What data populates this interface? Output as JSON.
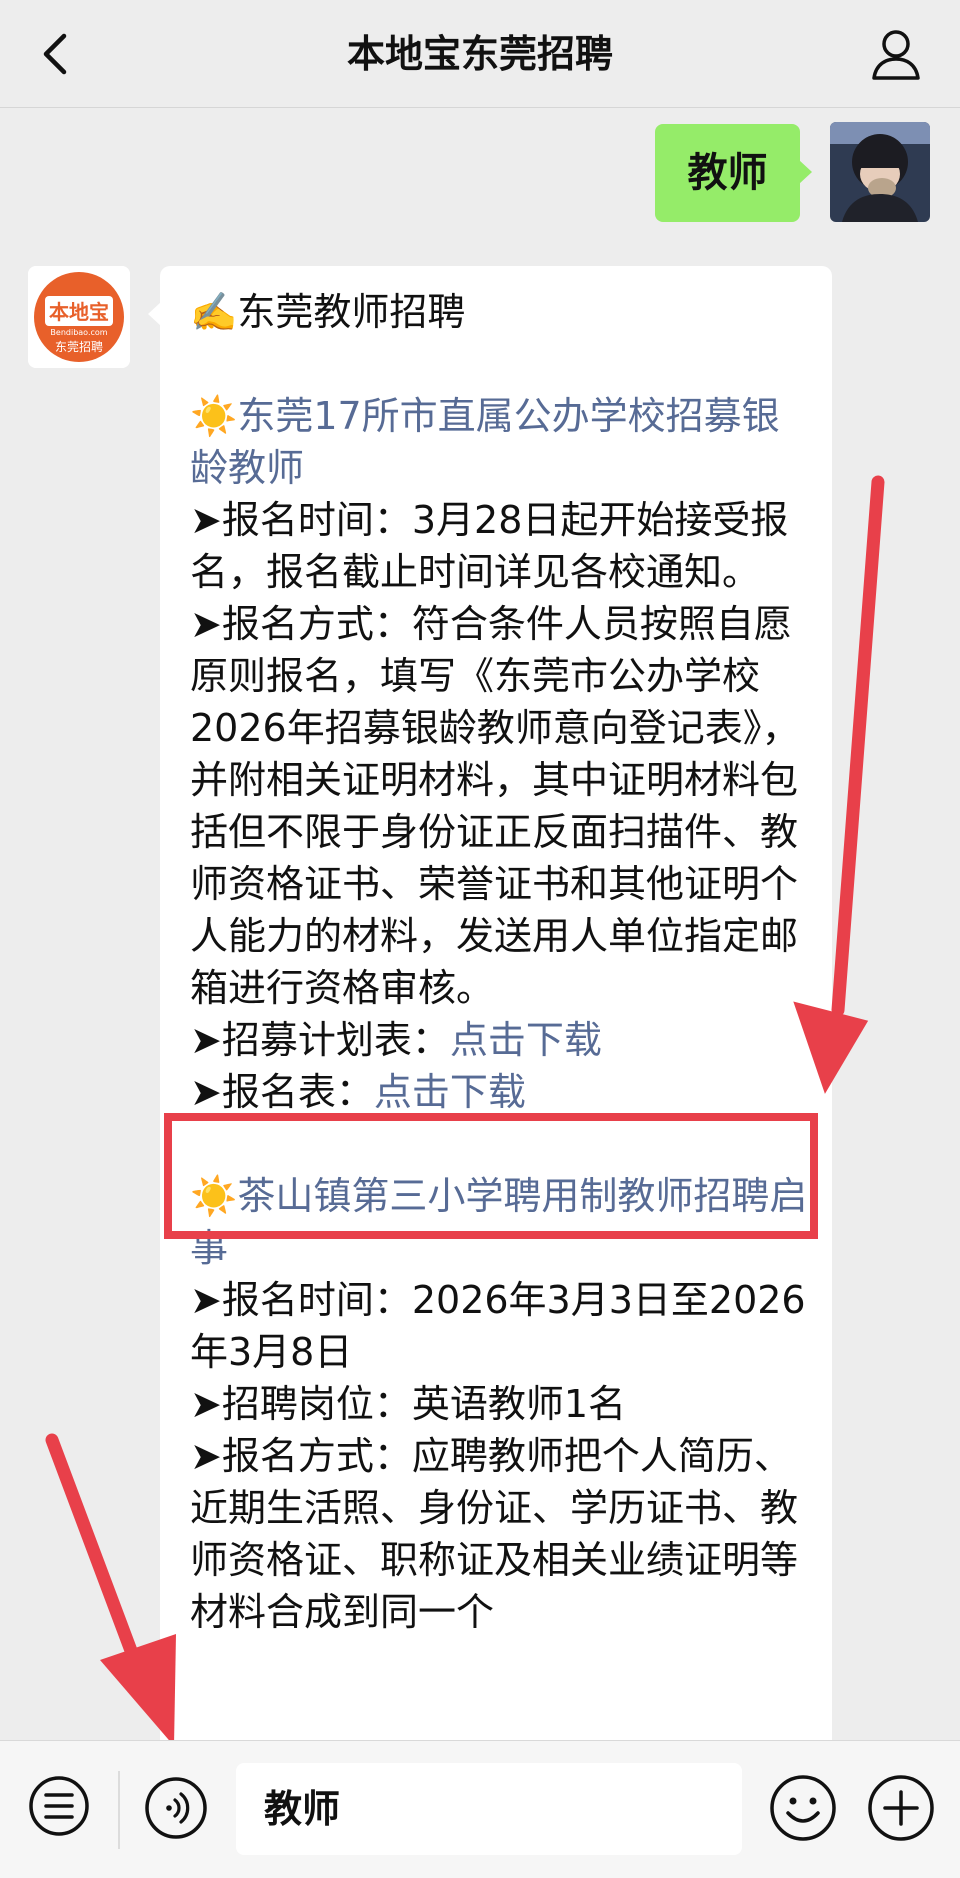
{
  "header": {
    "title": "本地宝东莞招聘"
  },
  "outgoing": {
    "text": "教师"
  },
  "incoming": {
    "avatar": {
      "brand": "本地宝",
      "domain": "Bendibao.com",
      "caption": "东莞招聘"
    },
    "heading_icon": "✍️",
    "heading": "东莞教师招聘",
    "sections": [
      {
        "icon": "☀️",
        "title": "东莞17所市直属公办学校招募银龄教师",
        "items": [
          {
            "bullet": "➤",
            "text": "报名时间：3月28日起开始接受报名，报名截止时间详见各校通知。"
          },
          {
            "bullet": "➤",
            "text": "报名方式：符合条件人员按照自愿原则报名，填写《东莞市公办学校2026年招募银龄教师意向登记表》，并附相关证明材料，其中证明材料包括但不限于身份证正反面扫描件、教师资格证书、荣誉证书和其他证明个人能力的材料，发送用人单位指定邮箱进行资格审核。"
          }
        ],
        "links": [
          {
            "bullet": "➤",
            "label": "招募计划表：",
            "link": "点击下载"
          },
          {
            "bullet": "➤",
            "label": "报名表：",
            "link": "点击下载"
          }
        ]
      },
      {
        "icon": "☀️",
        "title": "茶山镇第三小学聘用制教师招聘启事",
        "items": [
          {
            "bullet": "➤",
            "text": "报名时间：2026年3月3日至2026年3月8日"
          },
          {
            "bullet": "➤",
            "text": "招聘岗位：英语教师1名"
          },
          {
            "bullet": "➤",
            "text": "报名方式：应聘教师把个人简历、近期生活照、身份证、学历证书、教师资格证、职称证及相关业绩证明等材料合成到同一个"
          }
        ]
      }
    ]
  },
  "input": {
    "value": "教师"
  },
  "colors": {
    "background": "#ededed",
    "outgoing_bubble": "#95ec69",
    "link": "#576b95",
    "annotation_red": "#e8404a",
    "logo_orange": "#e8602a"
  },
  "icons": {
    "back": "chevron-left-icon",
    "profile": "user-icon",
    "menu": "menu-list-icon",
    "voice": "voice-icon",
    "emoji": "smiley-icon",
    "plus": "plus-circle-icon"
  }
}
